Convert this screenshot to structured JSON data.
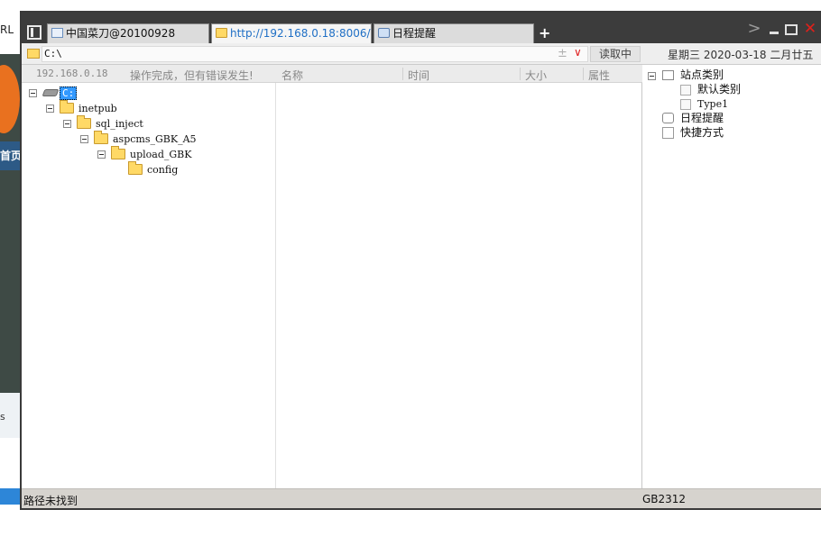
{
  "background_window": {
    "url_fragment": "RL",
    "nav_fragment": "首页",
    "foot_fragment": "s"
  },
  "window": {
    "tabs": [
      {
        "label": "中国菜刀@20100928",
        "icon": "page-icon",
        "active": false
      },
      {
        "label": "http://192.168.0.18:8006/co...",
        "icon": "folder-icon",
        "active": true
      },
      {
        "label": "日程提醒",
        "icon": "clock-icon",
        "active": false
      }
    ],
    "new_tab_label": "+",
    "nav_chevron": ">",
    "close_glyph": "✕"
  },
  "address": {
    "path": "C:\\",
    "plusminus": "±",
    "dropdown_glyph": "∨",
    "read_button": "读取中",
    "datetime": "星期三 2020-03-18 二月廿五"
  },
  "left_pane": {
    "ip": "192.168.0.18",
    "message": "操作完成，但有错误发生!",
    "tree": [
      {
        "label": "C:",
        "type": "drive",
        "level": 0,
        "expanded": true,
        "selected": true
      },
      {
        "label": "inetpub",
        "type": "folder",
        "level": 1,
        "expanded": true
      },
      {
        "label": "sql_inject",
        "type": "folder",
        "level": 2,
        "expanded": true
      },
      {
        "label": "aspcms_GBK_A5",
        "type": "folder",
        "level": 3,
        "expanded": true
      },
      {
        "label": "upload_GBK",
        "type": "folder",
        "level": 4,
        "expanded": true
      },
      {
        "label": "config",
        "type": "folder",
        "level": 5,
        "expanded": false
      }
    ]
  },
  "file_list": {
    "columns": [
      "名称",
      "时间",
      "大小",
      "属性"
    ],
    "rows": []
  },
  "right_pane": {
    "tree": [
      {
        "label": "站点类别",
        "type": "site-category",
        "level": 0,
        "expanded": true
      },
      {
        "label": "默认类别",
        "type": "page",
        "level": 1
      },
      {
        "label": "Type1",
        "type": "page",
        "level": 1
      },
      {
        "label": "日程提醒",
        "type": "clock",
        "level": 0
      },
      {
        "label": "快捷方式",
        "type": "shortcut",
        "level": 0
      }
    ]
  },
  "status": {
    "left": "路径未找到",
    "encoding": "GB2312"
  },
  "colors": {
    "titlebar": "#3c3c3c",
    "active_tab_text": "#1f6fc5",
    "selection": "#3399ff",
    "close_button": "#e0201a",
    "folder": "#ffd966",
    "statusbar": "#d6d3ce"
  }
}
